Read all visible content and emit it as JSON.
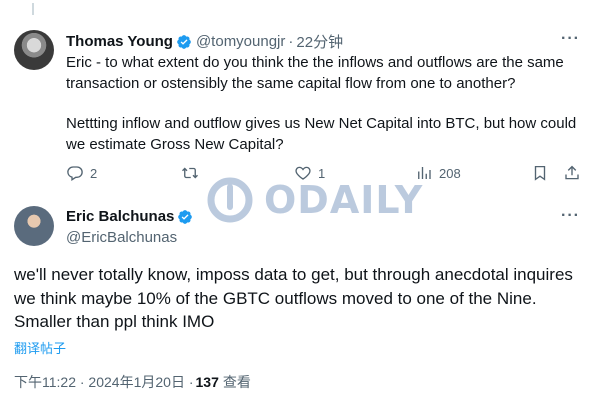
{
  "tweet1": {
    "name": "Thomas Young",
    "handle": "@tomyoungjr",
    "separator": "·",
    "time": "22分钟",
    "text_p1": "Eric - to what extent do you think the the inflows and outflows are the same transaction or ostensibly the same capital flow from one to another?",
    "text_p2": "Nettting inflow and outflow gives us New Net Capital into BTC, but how could we estimate Gross New Capital?",
    "replies": "2",
    "retweets": "",
    "likes": "1",
    "views": "208"
  },
  "watermark": {
    "text": "ODAILY"
  },
  "tweet2": {
    "name": "Eric Balchunas",
    "handle": "@EricBalchunas",
    "text": "we'll never totally know, imposs data to get, but through anecdotal inquires we think maybe 10% of the GBTC outflows moved to one of the Nine. Smaller than ppl think IMO",
    "translate": "翻译帖子",
    "timestamp": "下午11:22 · 2024年1月20日 · ",
    "view_count": "137",
    "view_label": "查看"
  },
  "colors": {
    "verified": "#1d9bf0",
    "secondary_text": "#536471",
    "link": "#1d9bf0"
  },
  "icons": [
    "more-icon",
    "reply-icon",
    "retweet-icon",
    "like-icon",
    "views-icon",
    "bookmark-icon",
    "share-icon",
    "verified-icon"
  ]
}
